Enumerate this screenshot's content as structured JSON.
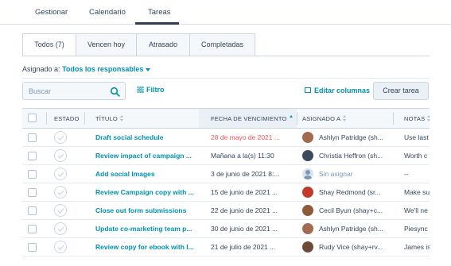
{
  "nav": {
    "tabs": [
      "Gestionar",
      "Calendario",
      "Tareas"
    ],
    "active_tab": "Tareas"
  },
  "views": {
    "tabs": [
      "Todos (7)",
      "Vencen hoy",
      "Atrasado",
      "Completadas"
    ],
    "active": "Todos (7)"
  },
  "filters": {
    "assigned_label": "Asignado a:",
    "assigned_value": "Todos los responsables"
  },
  "toolbar": {
    "search_placeholder": "Buscar",
    "filter_label": "Filtro",
    "edit_columns_label": "Editar columnas",
    "create_task_label": "Crear tarea"
  },
  "table": {
    "columns": [
      "ESTADO",
      "TÍTULO",
      "FECHA DE VENCIMIENTO",
      "ASIGNADO A",
      "NOTAS"
    ],
    "sorted_column": "FECHA DE VENCIMIENTO",
    "rows": [
      {
        "title": "Draft social schedule",
        "due": "28 de mayo de 2021 ...",
        "overdue": true,
        "assignee": "Ashlyn Patridge (sh...",
        "avatar_color": "#a26b4f",
        "notes": "Use last"
      },
      {
        "title": "Review impact of campaign ...",
        "due": "Mañana a la(s) 11:30",
        "overdue": false,
        "assignee": "Christia Heffron (sh...",
        "avatar_color": "#3d4a5c",
        "notes": "Worth c"
      },
      {
        "title": "Add social Images",
        "due": "3 de junio de 2021 8:...",
        "overdue": false,
        "assignee": "Sin asignar",
        "unassigned": true,
        "notes": "--"
      },
      {
        "title": "Review Campaign copy with ...",
        "due": "15 de junio de 2021 ...",
        "overdue": false,
        "assignee": "Shay Redmond (sr...",
        "avatar_color": "#c0392b",
        "notes": "Make su"
      },
      {
        "title": "Close out form submissions",
        "due": "22 de junio de 2021 ...",
        "overdue": false,
        "assignee": "Cecil Byun (shay+c...",
        "avatar_color": "#8e5a3c",
        "notes": "We'll ne"
      },
      {
        "title": "Update co-marketing team p...",
        "due": "30 de junio de 2021 ...",
        "overdue": false,
        "assignee": "Ashlyn Patridge (sh...",
        "avatar_color": "#a26b4f",
        "notes": "Piesync"
      },
      {
        "title": "Review copy for ebook with I...",
        "due": "21 de julio de 2021 ...",
        "overdue": false,
        "assignee": "Rudy Vice (shay+rv...",
        "avatar_color": "#6b4a3a",
        "notes": "James is"
      }
    ]
  },
  "colors": {
    "link": "#0091ae",
    "overdue": "#f2545b",
    "text": "#33475b",
    "muted": "#7c98b6"
  }
}
